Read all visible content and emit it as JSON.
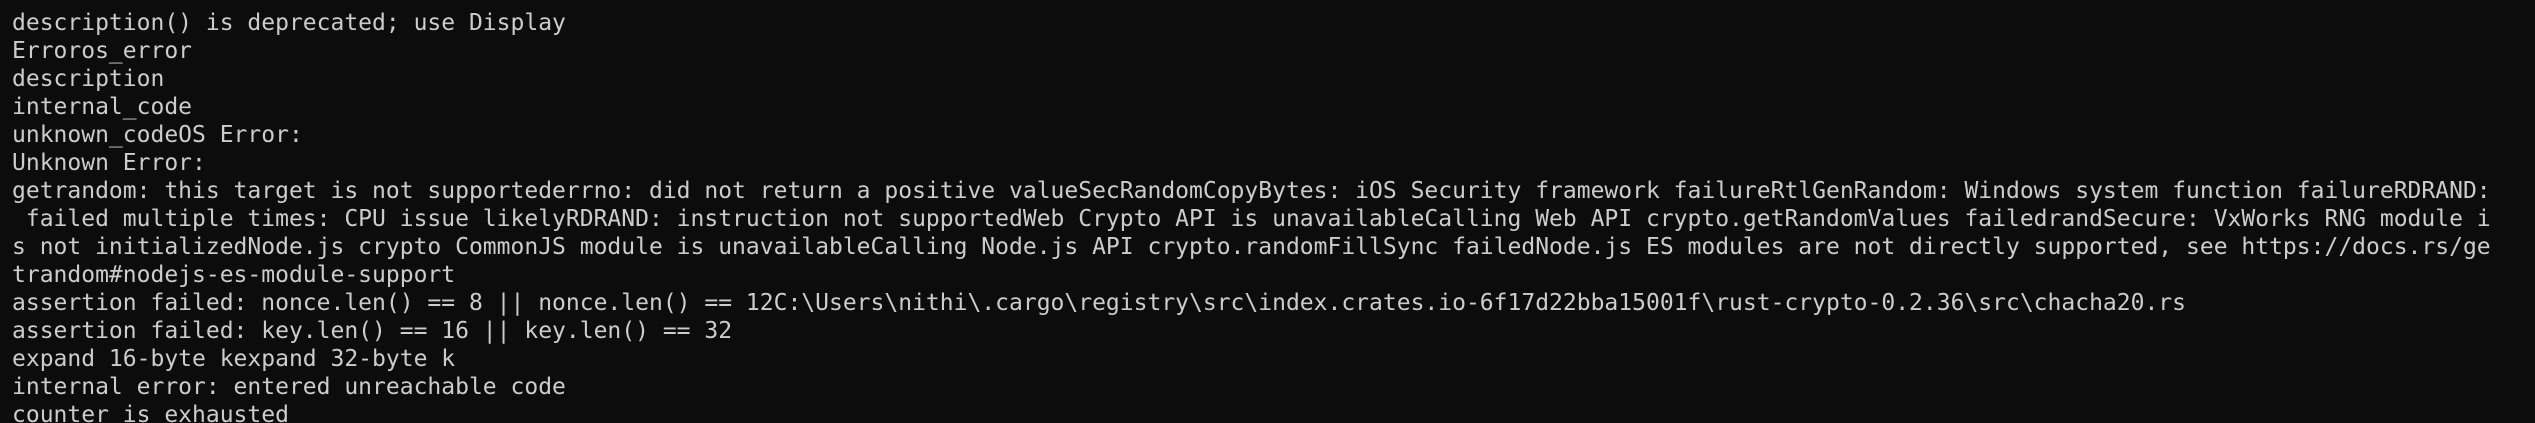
{
  "terminal": {
    "lines": [
      "",
      "description() is deprecated; use Display",
      "Erroros_error",
      "description",
      "internal_code",
      "unknown_codeOS Error: ",
      "Unknown Error: ",
      "getrandom: this target is not supportederrno: did not return a positive valueSecRandomCopyBytes: iOS Security framework failureRtlGenRandom: Windows system function failureRDRAND:",
      " failed multiple times: CPU issue likelyRDRAND: instruction not supportedWeb Crypto API is unavailableCalling Web API crypto.getRandomValues failedrandSecure: VxWorks RNG module i",
      "s not initializedNode.js crypto CommonJS module is unavailableCalling Node.js API crypto.randomFillSync failedNode.js ES modules are not directly supported, see https://docs.rs/ge",
      "trandom#nodejs-es-module-support",
      "assertion failed: nonce.len() == 8 || nonce.len() == 12C:\\Users\\nithi\\.cargo\\registry\\src\\index.crates.io-6f17d22bba15001f\\rust-crypto-0.2.36\\src\\chacha20.rs",
      "assertion failed: key.len() == 16 || key.len() == 32",
      "expand 16-byte kexpand 32-byte k",
      "internal error: entered unreachable code",
      "counter is exhausted"
    ]
  }
}
